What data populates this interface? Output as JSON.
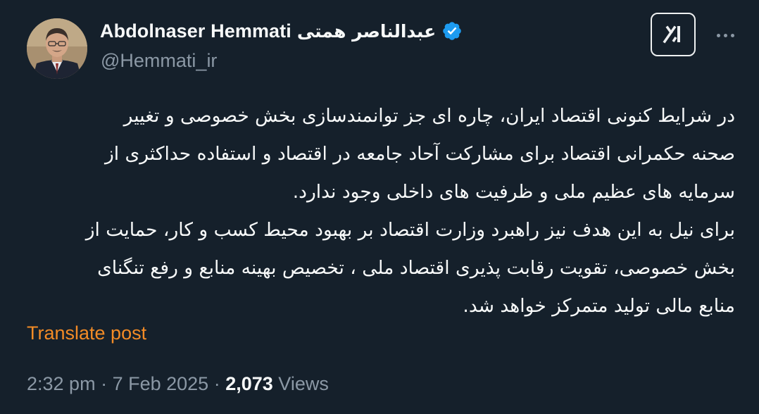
{
  "author": {
    "display_name": "Abdolnaser Hemmati",
    "persian_name": "عبدالناصر همتی",
    "handle": "@Hemmati_ir",
    "verified": true,
    "verified_color": "#1d9bf0"
  },
  "header": {
    "grok_icon": "grok-icon",
    "more_icon": "more-options-icon"
  },
  "post": {
    "lines": [
      "در شرایط کنونی اقتصاد ایران،  چاره ای جز توانمندسازی بخش خصوصی و تغییر",
      "صحنه حکمرانی اقتصاد برای مشارکت آحاد جامعه در اقتصاد و استفاده حداکثری از",
      "سرمایه های عظیم ملی و ظرفیت های داخلی وجود ندارد.",
      "برای نیل به این هدف نیز راهبرد وزارت اقتصاد بر بهبود محیط کسب و کار، حمایت از",
      "بخش خصوصی، تقویت رقابت پذیری اقتصاد ملی ، تخصیص بهینه منابع و رفع تنگنای",
      "منابع مالی تولید متمرکز خواهد شد."
    ],
    "translate_label": "Translate post"
  },
  "meta": {
    "time": "2:32 pm",
    "date": "7 Feb 2025",
    "views_count": "2,073",
    "views_label": "Views"
  },
  "colors": {
    "background": "#15202b",
    "text": "#f7f9f9",
    "secondary": "#8b98a5",
    "translate": "#f28b26"
  }
}
